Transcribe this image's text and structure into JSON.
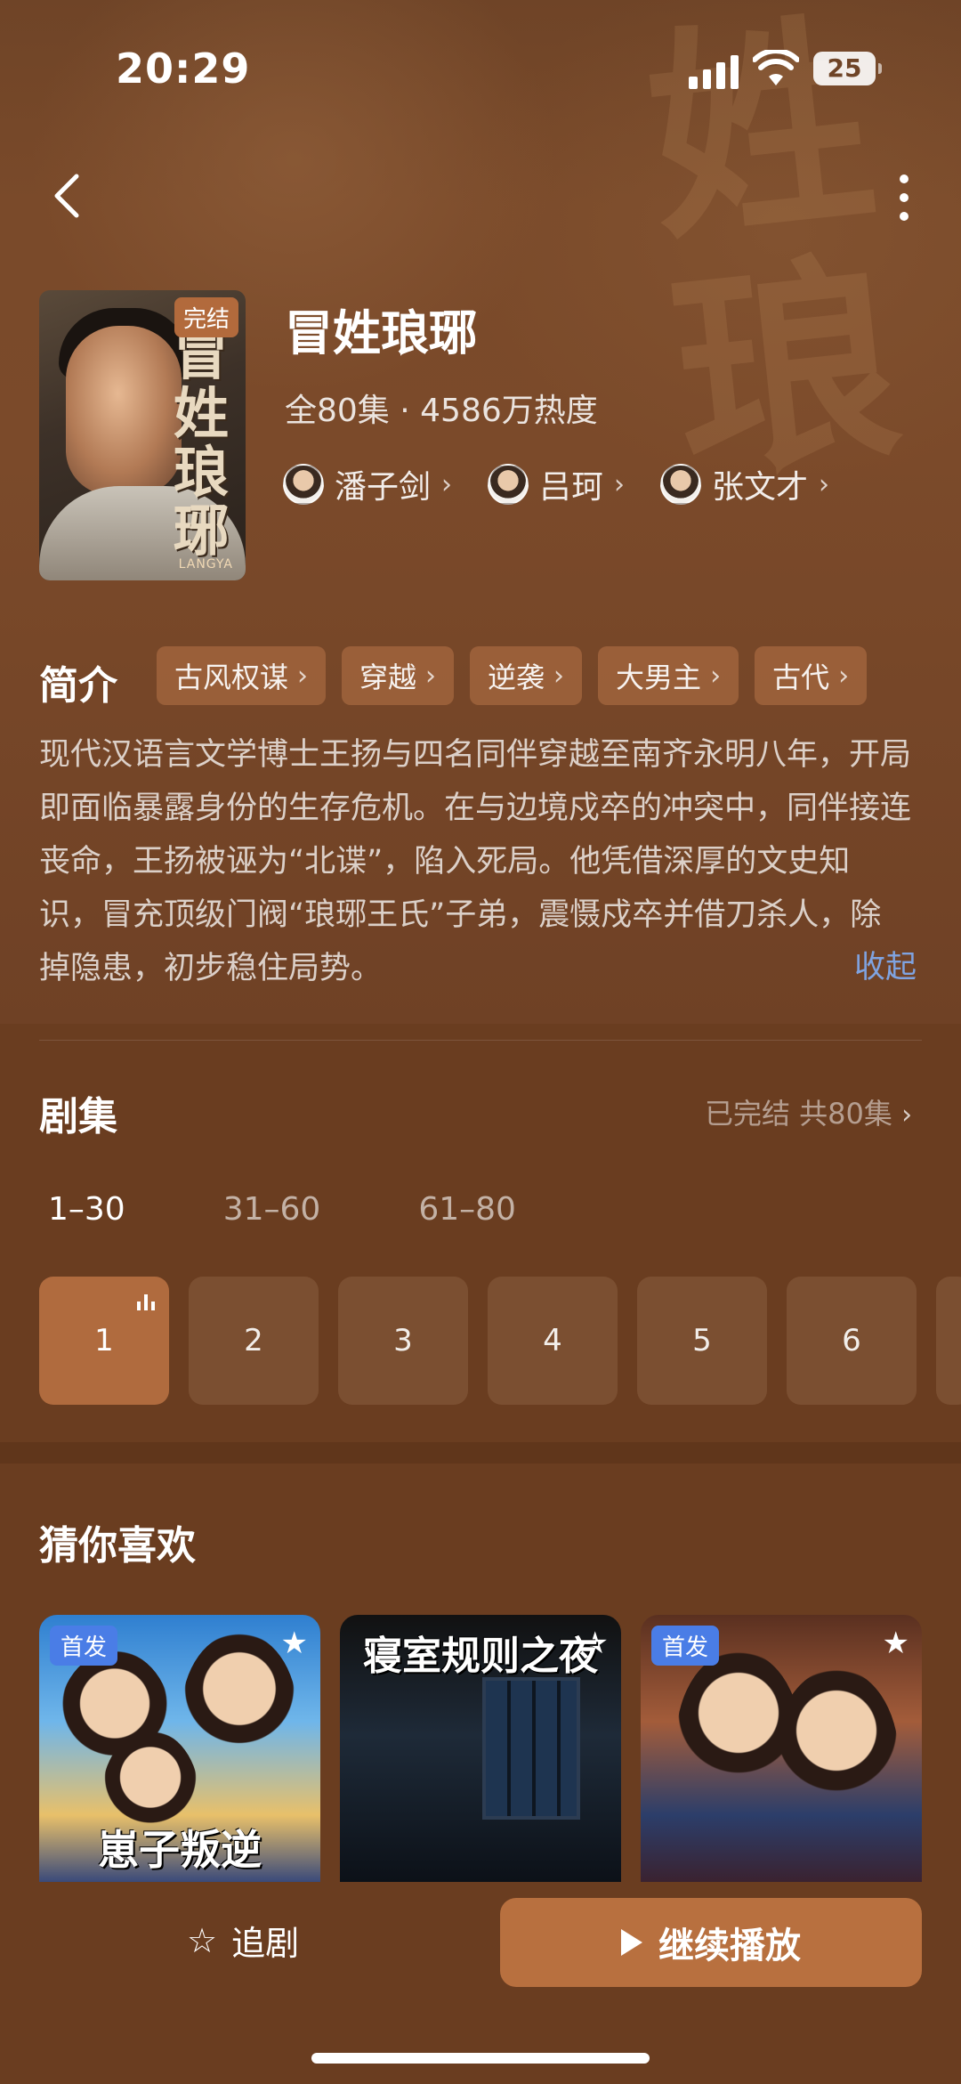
{
  "status_bar": {
    "time": "20:29",
    "battery": "25"
  },
  "drama": {
    "title": "冒姓琅琊",
    "meta": "全80集 · 4586万热度",
    "poster_badge": "完结",
    "poster_title": "冒姓琅琊",
    "poster_subtitle": "LANGYA",
    "actors": [
      {
        "name": "潘子剑"
      },
      {
        "name": "吕珂"
      },
      {
        "name": "张文才"
      }
    ]
  },
  "intro": {
    "label": "简介",
    "tags": [
      "古风权谋",
      "穿越",
      "逆袭",
      "大男主",
      "古代"
    ],
    "synopsis": "现代汉语言文学博士王扬与四名同伴穿越至南齐永明八年，开局即面临暴露身份的生存危机。在与边境戍卒的冲突中，同伴接连丧命，王扬被诬为“北谍”，陷入死局。他凭借深厚的文史知识，冒充顶级门阀“琅琊王氏”子弟，震慑戍卒并借刀杀人，除掉隐患，初步稳住局势。",
    "collapse_label": "收起"
  },
  "episodes": {
    "label": "剧集",
    "status": "已完结 共80集",
    "ranges": [
      "1–30",
      "31–60",
      "61–80"
    ],
    "active_range": 0,
    "items": [
      "1",
      "2",
      "3",
      "4",
      "5",
      "6"
    ],
    "active_item": 0
  },
  "recommend": {
    "label": "猜你喜欢",
    "cards": [
      {
        "badge": "首发",
        "caption": "崽子叛逆"
      },
      {
        "badge": "",
        "caption": "寝室规则之夜"
      },
      {
        "badge": "首发",
        "caption": ""
      }
    ]
  },
  "actions": {
    "follow_label": "追剧",
    "play_label": "继续播放"
  },
  "colors": {
    "accent": "#b8703f",
    "link": "#7fa3e0",
    "badge_blue": "#4a7de6"
  }
}
